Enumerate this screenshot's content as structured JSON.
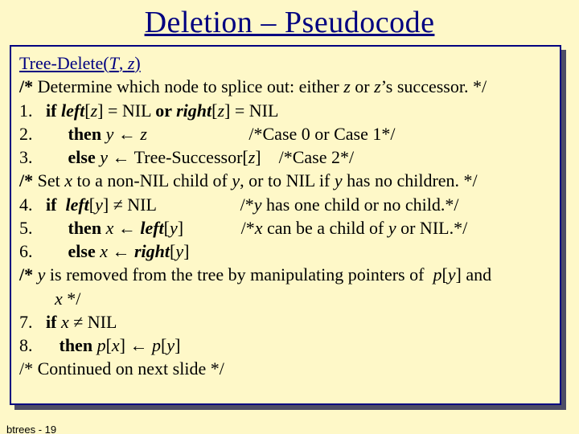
{
  "title": "Deletion – Pseudocode",
  "signature": {
    "name": "Tree-Delete(",
    "arg1": "T",
    "sep": ", ",
    "arg2": "z",
    "close": ")"
  },
  "c1a": "/* ",
  "c1b": "Determine which node to splice out: either ",
  "c1c": "z",
  "c1d": " or ",
  "c1e": "z",
  "c1f": "’s successor. */",
  "l1n": "1.   ",
  "l1a": "if ",
  "l1b": "left",
  "l1c": "[",
  "l1d": "z",
  "l1e": "] = NIL ",
  "l1f": "or ",
  "l1g": "right",
  "l1h": "[",
  "l1i": "z",
  "l1j": "] = NIL",
  "l2n": "2.        ",
  "l2a": "then ",
  "l2b": "y",
  "l2c": " ← ",
  "l2d": "z",
  "l2sp": "                       ",
  "l2e": "/*Case 0 or Case 1*/",
  "l3n": "3.        ",
  "l3a": "else ",
  "l3b": "y",
  "l3c": " ← Tree-Successor[",
  "l3d": "z",
  "l3e": "]",
  "l3sp": "    ",
  "l3f": "/*Case 2*/",
  "c2a": "/* ",
  "c2b": "Set ",
  "c2c": "x",
  "c2d": " to a non-NIL child of ",
  "c2e": "y",
  "c2f": ", or to NIL if ",
  "c2g": "y",
  "c2h": " has no children. */",
  "l4n": "4.   ",
  "l4a": "if  ",
  "l4b": "left",
  "l4c": "[",
  "l4d": "y",
  "l4e": "] ≠ NIL",
  "l4sp": "                   ",
  "l4f": "/*",
  "l4g": "y",
  "l4h": " has one child or no child.",
  "l4i": "*/",
  "l5n": "5.        ",
  "l5a": "then ",
  "l5b": "x",
  "l5c": " ← ",
  "l5d": "left",
  "l5e": "[",
  "l5f": "y",
  "l5g": "]",
  "l5sp": "             ",
  "l5h": "/*",
  "l5i": "x",
  "l5j": " can be a child of ",
  "l5k": "y",
  "l5m": " or NIL.",
  "l5n2": "*/",
  "l6n": "6.        ",
  "l6a": "else ",
  "l6b": "x",
  "l6c": " ← ",
  "l6d": "right",
  "l6e": "[",
  "l6f": "y",
  "l6g": "]",
  "c3a": "/* ",
  "c3b": "y",
  "c3c": " is removed from the tree by manipulating pointers of  ",
  "c3d": "p",
  "c3e": "[",
  "c3f": "y",
  "c3g": "] and",
  "c3h": "        ",
  "c3i": "x ",
  "c3j": "*/",
  "l7n": "7.   ",
  "l7a": "if ",
  "l7b": "x",
  "l7c": " ≠ NIL",
  "l8n": "8.      ",
  "l8a": "then ",
  "l8b": "p",
  "l8c": "[",
  "l8d": "x",
  "l8e": "] ← ",
  "l8f": "p",
  "l8g": "[",
  "l8h": "y",
  "l8i": "]",
  "c4": "/* Continued on next slide */",
  "footer": "btrees - 19"
}
